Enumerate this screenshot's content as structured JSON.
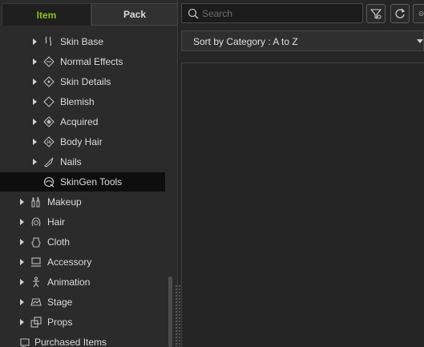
{
  "tabs": {
    "item": "Item",
    "pack": "Pack"
  },
  "search": {
    "placeholder": "Search"
  },
  "sort": {
    "label": "Sort by Category : A to Z"
  },
  "tree": {
    "items": [
      {
        "label": "Skin Base",
        "icon": "skin-base-icon"
      },
      {
        "label": "Normal Effects",
        "icon": "normal-effects-icon"
      },
      {
        "label": "Skin Details",
        "icon": "skin-details-icon"
      },
      {
        "label": "Blemish",
        "icon": "blemish-icon"
      },
      {
        "label": "Acquired",
        "icon": "acquired-icon"
      },
      {
        "label": "Body Hair",
        "icon": "body-hair-icon"
      },
      {
        "label": "Nails",
        "icon": "nails-icon"
      },
      {
        "label": "SkinGen Tools",
        "icon": "skingen-tools-icon"
      },
      {
        "label": "Makeup",
        "icon": "makeup-icon"
      },
      {
        "label": "Hair",
        "icon": "hair-icon"
      },
      {
        "label": "Cloth",
        "icon": "cloth-icon"
      },
      {
        "label": "Accessory",
        "icon": "accessory-icon"
      },
      {
        "label": "Animation",
        "icon": "animation-icon"
      },
      {
        "label": "Stage",
        "icon": "stage-icon"
      },
      {
        "label": "Props",
        "icon": "props-icon"
      },
      {
        "label": "Purchased Items",
        "icon": "purchased-items-icon"
      }
    ]
  },
  "colors": {
    "accent": "#8fc21f",
    "selected_row": "#0e0e0e"
  }
}
